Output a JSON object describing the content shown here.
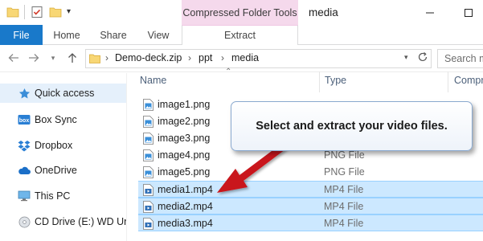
{
  "ribbon": {
    "context_header": "Compressed Folder Tools",
    "window_title": "media",
    "tabs": [
      {
        "label": "File"
      },
      {
        "label": "Home"
      },
      {
        "label": "Share"
      },
      {
        "label": "View"
      },
      {
        "label": "Extract"
      }
    ]
  },
  "address": {
    "breadcrumbs": [
      "Demo-deck.zip",
      "ppt",
      "media"
    ],
    "search_placeholder": "Search m"
  },
  "nav_pane": {
    "items": [
      {
        "label": "Quick access",
        "icon": "star-icon"
      },
      {
        "label": "Box Sync",
        "icon": "box-icon"
      },
      {
        "label": "Dropbox",
        "icon": "dropbox-icon"
      },
      {
        "label": "OneDrive",
        "icon": "cloud-icon"
      },
      {
        "label": "This PC",
        "icon": "monitor-icon"
      },
      {
        "label": "CD Drive (E:) WD Unlo",
        "icon": "disc-icon"
      }
    ]
  },
  "file_list": {
    "columns": [
      "Name",
      "Type",
      "Compr"
    ],
    "rows": [
      {
        "name": "image1.png",
        "type": "",
        "selected": false
      },
      {
        "name": "image2.png",
        "type": "",
        "selected": false
      },
      {
        "name": "image3.png",
        "type": "",
        "selected": false
      },
      {
        "name": "image4.png",
        "type": "PNG File",
        "selected": false
      },
      {
        "name": "image5.png",
        "type": "PNG File",
        "selected": false
      },
      {
        "name": "media1.mp4",
        "type": "MP4 File",
        "selected": true
      },
      {
        "name": "media2.mp4",
        "type": "MP4 File",
        "selected": true
      },
      {
        "name": "media3.mp4",
        "type": "MP4 File",
        "selected": true
      }
    ]
  },
  "callout": {
    "text": "Select and extract your video files."
  },
  "colors": {
    "file_tab": "#1979ca",
    "context_tab": "#f5d9ec",
    "selection": "#cce8ff",
    "arrow": "#c9141b"
  }
}
